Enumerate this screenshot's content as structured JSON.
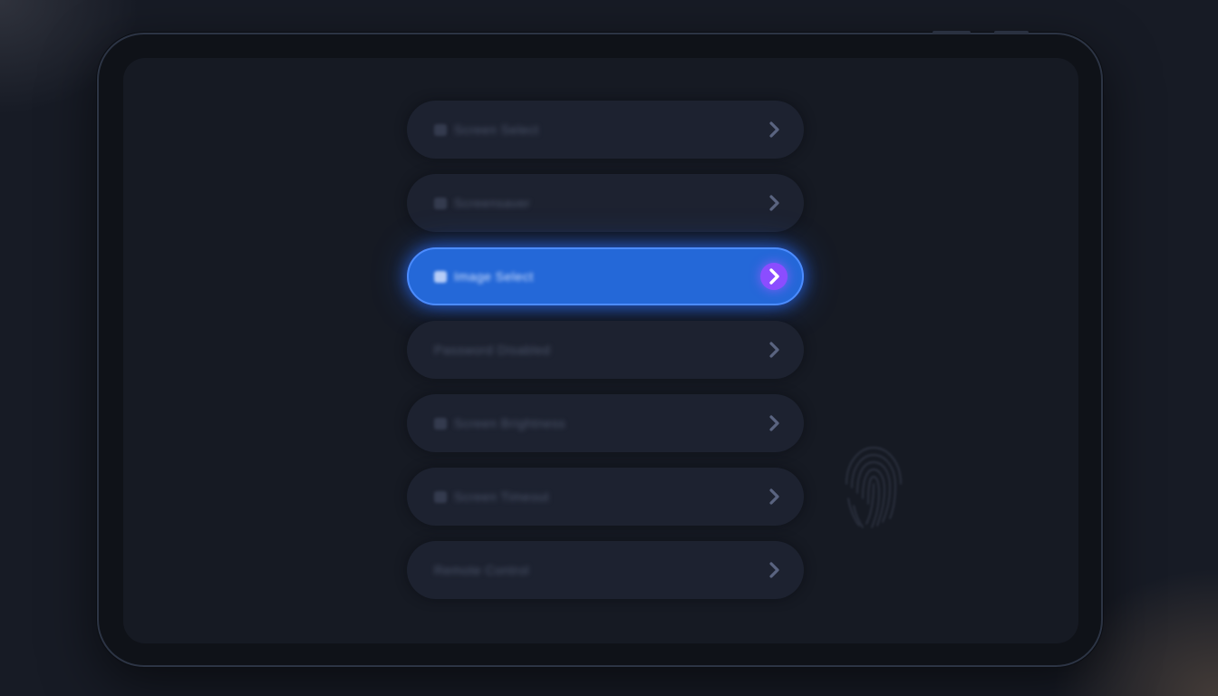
{
  "menu": {
    "items": [
      {
        "label": "Screen Select",
        "has_icon": true,
        "active": false
      },
      {
        "label": "Screensaver",
        "has_icon": true,
        "active": false
      },
      {
        "label": "Image Select",
        "has_icon": true,
        "active": true
      },
      {
        "label": "Password Disabled",
        "has_icon": false,
        "active": false
      },
      {
        "label": "Screen Brightness",
        "has_icon": true,
        "active": false
      },
      {
        "label": "Screen Timeout",
        "has_icon": true,
        "active": false
      },
      {
        "label": "Remote Control",
        "has_icon": false,
        "active": false
      }
    ]
  },
  "icons": {
    "chevron": "chevron-right-icon",
    "fingerprint": "fingerprint-icon"
  },
  "colors": {
    "background": "#171b25",
    "item": "#1d2230",
    "active": "#2468d8",
    "active_badge": "#8b4dff",
    "chevron": "#5a6480"
  }
}
